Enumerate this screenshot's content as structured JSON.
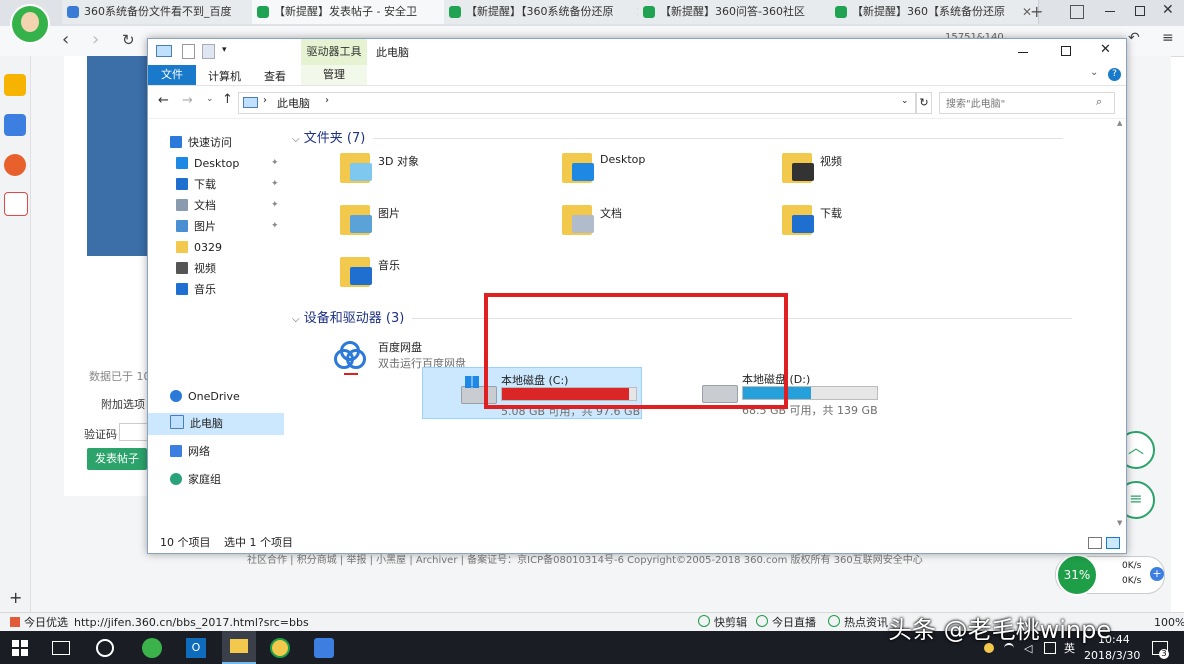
{
  "browser": {
    "tabs": [
      {
        "label": "360系统备份文件看不到_百度",
        "color": "#3a7bd5",
        "active": false
      },
      {
        "label": "【新提醒】发表帖子 - 安全卫",
        "color": "#1fa352",
        "active": true
      },
      {
        "label": "【新提醒】【360系统备份还原",
        "color": "#1fa352",
        "active": false
      },
      {
        "label": "【新提醒】360问答-360社区",
        "color": "#1fa352",
        "active": false
      },
      {
        "label": "【新提醒】360【系统备份还原",
        "color": "#1fa352",
        "active": false
      }
    ],
    "new_tab": "+",
    "address_fragment": "15751&140",
    "status_url": "http://jifen.360.cn/bbs_2017.html?src=bbs",
    "status_left": "今日优选",
    "status_items": [
      "快剪辑",
      "今日直播",
      "热点资讯"
    ],
    "zoom": "100%"
  },
  "webpage": {
    "data_label": "数据已于 10",
    "attach_label": "附加选项",
    "captcha_label": "验证码",
    "submit_label": "发表帖子",
    "footer": "社区合作 | 积分商城 | 举报 | 小黑屋 | Archiver | 备案证号：京ICP备08010314号-6 Copyright©2005-2018 360.com 版权所有 360互联网安全中心",
    "speed": {
      "percent": "31%",
      "up": "0K/s",
      "down": "0K/s"
    }
  },
  "explorer": {
    "context_tab_group": "驱动器工具",
    "window_title": "此电脑",
    "ribbon_tabs": [
      "文件",
      "计算机",
      "查看",
      "管理"
    ],
    "address": "此电脑",
    "search_placeholder": "搜索\"此电脑\"",
    "nav": {
      "quick_access": "快速访问",
      "quick_items": [
        {
          "label": "Desktop",
          "color": "#1e88e5",
          "pinned": true
        },
        {
          "label": "下载",
          "color": "#1e6fd0",
          "pinned": true
        },
        {
          "label": "文档",
          "color": "#8a9bb0",
          "pinned": true
        },
        {
          "label": "图片",
          "color": "#4a8fd1",
          "pinned": true
        },
        {
          "label": "0329",
          "color": "#f2c94c",
          "pinned": false
        },
        {
          "label": "视频",
          "color": "#555555",
          "pinned": false
        },
        {
          "label": "音乐",
          "color": "#1e6fd0",
          "pinned": false
        }
      ],
      "onedrive": "OneDrive",
      "this_pc": "此电脑",
      "network": "网络",
      "homegroup": "家庭组"
    },
    "folders_header": "文件夹 (7)",
    "folders": [
      "3D 对象",
      "Desktop",
      "视频",
      "图片",
      "文档",
      "下载",
      "音乐"
    ],
    "devices_header": "设备和驱动器 (3)",
    "baidu": {
      "name": "百度网盘",
      "desc": "双击运行百度网盘"
    },
    "drives": [
      {
        "name": "本地磁盘 (C:)",
        "free": "5.08 GB 可用，共 97.6 GB",
        "used_fraction": 0.948,
        "bar_color": "#da2626",
        "selected": true
      },
      {
        "name": "本地磁盘 (D:)",
        "free": "68.5 GB 可用，共 139 GB",
        "used_fraction": 0.507,
        "bar_color": "#26a0da",
        "selected": false
      }
    ],
    "status_count": "10 个项目",
    "status_selected": "选中 1 个项目",
    "highlight_color": "#e02020"
  },
  "taskbar": {
    "time": "10:44",
    "date": "2018/3/30",
    "lang": "英",
    "notif_count": "3"
  },
  "watermark": "头条 @老毛桃winpe"
}
